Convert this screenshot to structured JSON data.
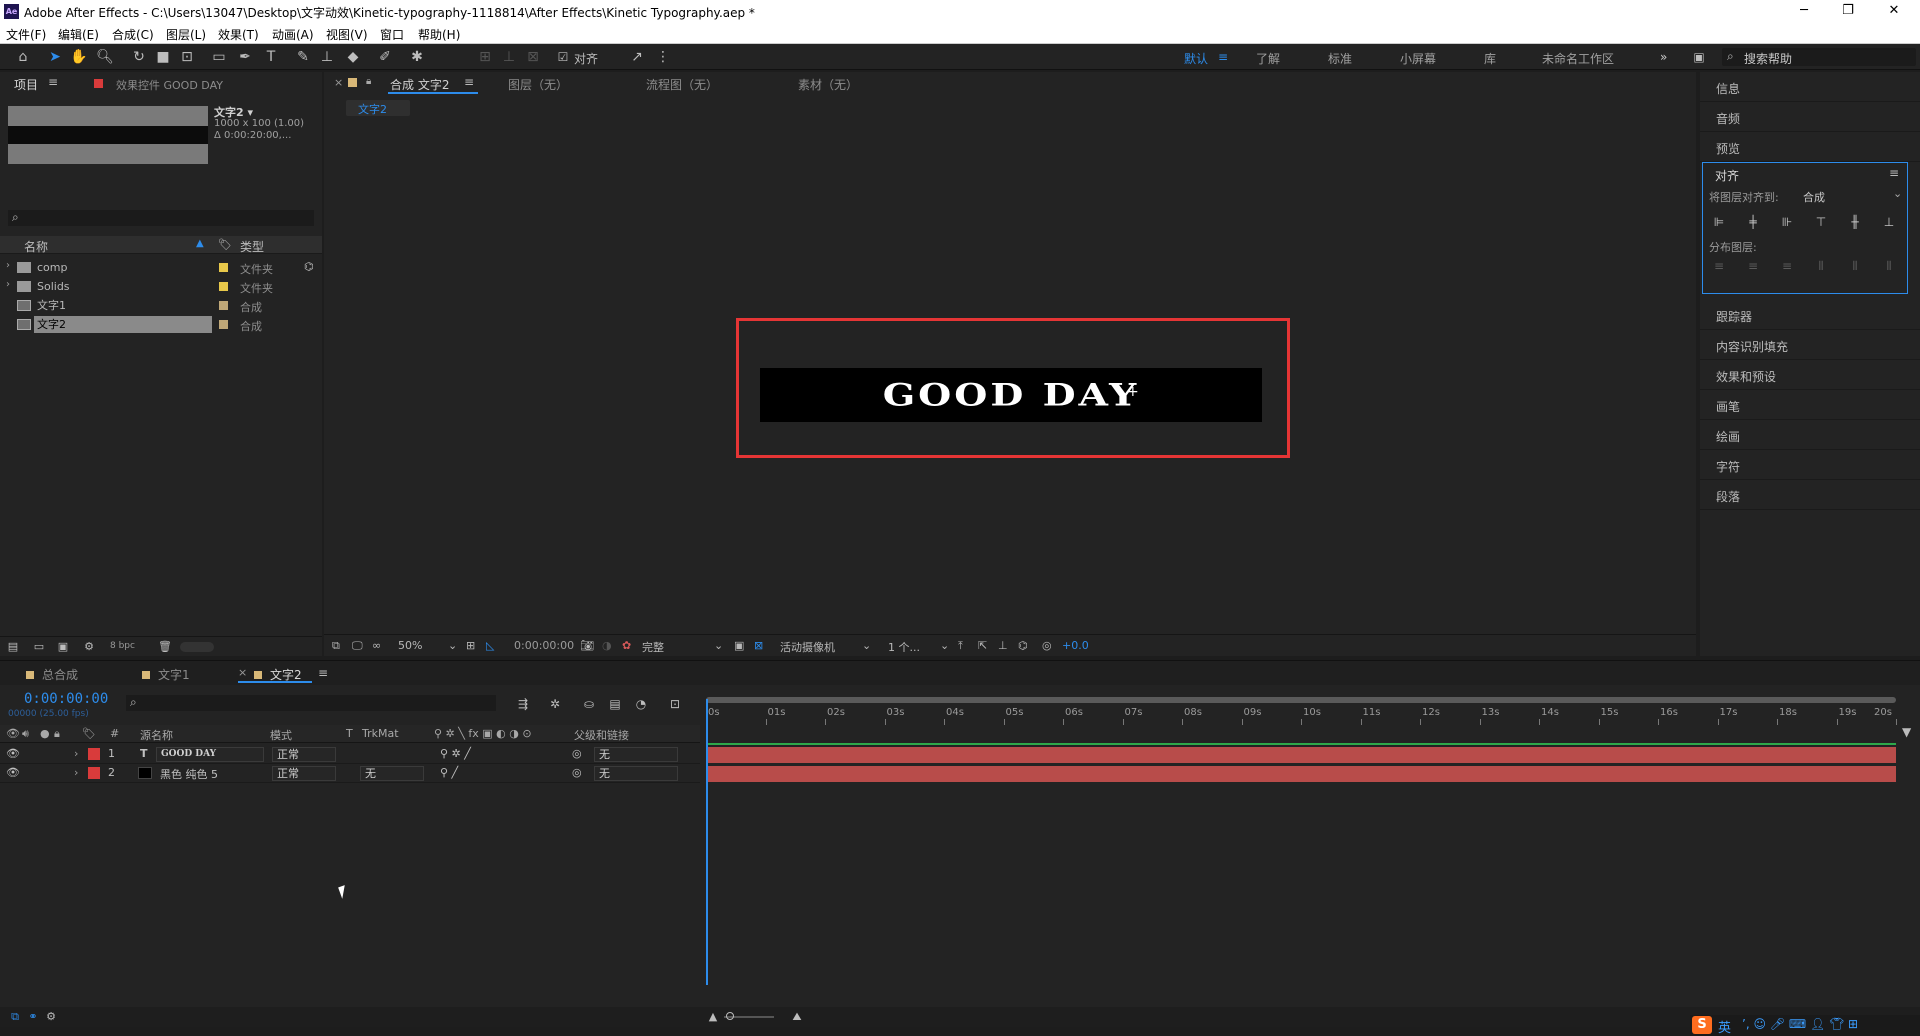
{
  "titlebar": {
    "app_icon": "Ae",
    "title": "Adobe After Effects - C:\\Users\\13047\\Desktop\\文字动效\\Kinetic-typography-1118814\\After Effects\\Kinetic Typography.aep *",
    "minimize": "─",
    "maximize": "❐",
    "close": "✕"
  },
  "menu": {
    "items": [
      "文件(F)",
      "编辑(E)",
      "合成(C)",
      "图层(L)",
      "效果(T)",
      "动画(A)",
      "视图(V)",
      "窗口",
      "帮助(H)"
    ]
  },
  "toolbar": {
    "snap_label": "对齐",
    "workspaces": [
      "默认",
      "了解",
      "标准",
      "小屏幕",
      "库",
      "未命名工作区"
    ],
    "active_workspace": "默认",
    "overflow": "»",
    "search_help": "搜索帮助"
  },
  "project": {
    "tab_label": "项目",
    "effects_tab": "效果控件 GOOD DAY",
    "selected_name": "文字2 ▾",
    "selected_info1": "1000 x 100 (1.00)",
    "selected_info2": "Δ 0:00:20:00,...",
    "search_icon": "⌕",
    "col_name": "名称",
    "col_type": "类型",
    "items": [
      {
        "name": "comp",
        "type": "文件夹",
        "swatch": "#e8c84a"
      },
      {
        "name": "Solids",
        "type": "文件夹",
        "swatch": "#e8c84a"
      },
      {
        "name": "文字1",
        "type": "合成",
        "swatch": "#c0a878"
      },
      {
        "name": "文字2",
        "type": "合成",
        "swatch": "#c0a878"
      }
    ],
    "bpc": "8 bpc"
  },
  "composition": {
    "tab_comp": "合成 文字2",
    "tab_layer": "图层（无）",
    "tab_flow": "流程图（无）",
    "tab_footage": "素材（无）",
    "subtab": "文字2",
    "comp_text": "GOOD DAY",
    "zoom": "50%",
    "timecode": "0:00:00:00",
    "resolution": "完整",
    "camera": "活动摄像机",
    "views": "1 个...",
    "exposure": "+0.0"
  },
  "right_panels": {
    "info": "信息",
    "audio": "音频",
    "preview": "预览",
    "align": "对齐",
    "align_to_label": "将图层对齐到:",
    "align_to_value": "合成",
    "distribute_label": "分布图层:",
    "tracker": "跟踪器",
    "content_fill": "内容识别填充",
    "effects_presets": "效果和预设",
    "brushes": "画笔",
    "paint": "绘画",
    "character": "字符",
    "paragraph": "段落"
  },
  "timeline": {
    "tabs": [
      "总合成",
      "文字1",
      "文字2"
    ],
    "active_tab": "文字2",
    "timecode": "0:00:00:00",
    "fps": "00000 (25.00 fps)",
    "headers": {
      "num": "#",
      "source": "源名称",
      "mode": "模式",
      "t": "T",
      "trkmat": "TrkMat",
      "parent": "父级和链接"
    },
    "layers": [
      {
        "num": "1",
        "type_icon": "T",
        "name": "GOOD DAY",
        "mode": "正常",
        "trkmat": "",
        "parent": "无"
      },
      {
        "num": "2",
        "type_icon": "",
        "name": "黑色 纯色 5",
        "mode": "正常",
        "trkmat": "无",
        "parent": "无"
      }
    ],
    "ticks": [
      "0s",
      "01s",
      "02s",
      "03s",
      "04s",
      "05s",
      "06s",
      "07s",
      "08s",
      "09s",
      "10s",
      "11s",
      "12s",
      "13s",
      "14s",
      "15s",
      "16s",
      "17s",
      "18s",
      "19s",
      "20s"
    ]
  },
  "tray": {
    "ime": "S",
    "lang": "英"
  },
  "colors": {
    "accent": "#2d8ceb",
    "layer_red": "#d93b3b",
    "bar_red": "#b84c4a",
    "frame_red": "#e53535"
  }
}
